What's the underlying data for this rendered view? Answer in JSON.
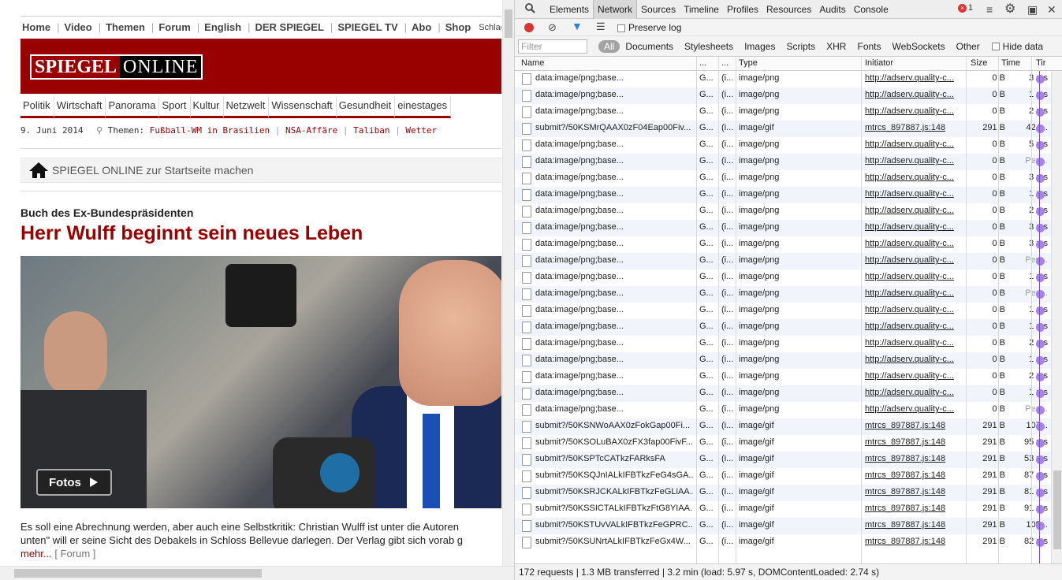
{
  "page": {
    "topnav": [
      "Home",
      "Video",
      "Themen",
      "Forum",
      "English",
      "DER SPIEGEL",
      "SPIEGEL TV",
      "Abo",
      "Shop"
    ],
    "search_label": "Schlag:",
    "logo_left": "SPIEGEL",
    "logo_right": "ONLINE",
    "categories": [
      "Politik",
      "Wirtschaft",
      "Panorama",
      "Sport",
      "Kultur",
      "Netzwelt",
      "Wissenschaft",
      "Gesundheit",
      "einestages"
    ],
    "category_colors": [
      "#990000",
      "#990000",
      "#990000",
      "#990000",
      "#990000",
      "#990000",
      "#990000",
      "#990000",
      "#990000"
    ],
    "date": "9. Juni 2014",
    "themen_label": "Themen:",
    "topics": [
      "Fußball-WM in Brasilien",
      "NSA-Affäre",
      "Taliban",
      "Wetter"
    ],
    "home_bar": "SPIEGEL ONLINE zur Startseite machen",
    "kicker": "Buch des Ex-Bundespräsidenten",
    "headline": "Herr Wulff beginnt sein neues Leben",
    "fotos_label": "Fotos",
    "teaser_line1": "Es soll eine Abrechnung werden, aber auch eine Selbstkritik: Christian Wulff ist unter die Autoren",
    "teaser_line2": "unten\" will er seine Sicht des Debakels in Schloss Bellevue darlegen. Der Verlag gibt sich vorab g",
    "more_label": "mehr...",
    "forum_label": "[ Forum ]"
  },
  "devtools": {
    "tabs": [
      "Elements",
      "Network",
      "Sources",
      "Timeline",
      "Profiles",
      "Resources",
      "Audits",
      "Console"
    ],
    "active_tab": "Network",
    "error_count": "1",
    "preserve_log": "Preserve log",
    "filter_placeholder": "Filter",
    "filter_types": [
      "All",
      "Documents",
      "Stylesheets",
      "Images",
      "Scripts",
      "XHR",
      "Fonts",
      "WebSockets",
      "Other"
    ],
    "hide_data": "Hide data",
    "columns": [
      "Name",
      "...",
      "...",
      "Type",
      "Initiator",
      "Size",
      "Time",
      "Tir"
    ],
    "rows": [
      {
        "name": "data:image/png;base...",
        "m1": "G...",
        "m2": "(i...",
        "type": "image/png",
        "init": "http://adserv.quality-c...",
        "size": "0 B",
        "time": "3 ms"
      },
      {
        "name": "data:image/png;base...",
        "m1": "G...",
        "m2": "(i...",
        "type": "image/png",
        "init": "http://adserv.quality-c...",
        "size": "0 B",
        "time": "1 ms"
      },
      {
        "name": "data:image/png;base...",
        "m1": "G...",
        "m2": "(i...",
        "type": "image/png",
        "init": "http://adserv.quality-c...",
        "size": "0 B",
        "time": "2 ms"
      },
      {
        "name": "submit?/50KSMrQAAX0zF04Eap00Fiv...",
        "m1": "G...",
        "m2": "(i...",
        "type": "image/gif",
        "init": "mtrcs_897887.js:148",
        "size": "291 B",
        "time": "424..."
      },
      {
        "name": "data:image/png;base...",
        "m1": "G...",
        "m2": "(i...",
        "type": "image/png",
        "init": "http://adserv.quality-c...",
        "size": "0 B",
        "time": "5 ms"
      },
      {
        "name": "data:image/png;base...",
        "m1": "G...",
        "m2": "(i...",
        "type": "image/png",
        "init": "http://adserv.quality-c...",
        "size": "0 B",
        "time": "Pen..."
      },
      {
        "name": "data:image/png;base...",
        "m1": "G...",
        "m2": "(i...",
        "type": "image/png",
        "init": "http://adserv.quality-c...",
        "size": "0 B",
        "time": "3 ms"
      },
      {
        "name": "data:image/png;base...",
        "m1": "G...",
        "m2": "(i...",
        "type": "image/png",
        "init": "http://adserv.quality-c...",
        "size": "0 B",
        "time": "1 ms"
      },
      {
        "name": "data:image/png;base...",
        "m1": "G...",
        "m2": "(i...",
        "type": "image/png",
        "init": "http://adserv.quality-c...",
        "size": "0 B",
        "time": "2 ms"
      },
      {
        "name": "data:image/png;base...",
        "m1": "G...",
        "m2": "(i...",
        "type": "image/png",
        "init": "http://adserv.quality-c...",
        "size": "0 B",
        "time": "3 ms"
      },
      {
        "name": "data:image/png;base...",
        "m1": "G...",
        "m2": "(i...",
        "type": "image/png",
        "init": "http://adserv.quality-c...",
        "size": "0 B",
        "time": "3 ms"
      },
      {
        "name": "data:image/png;base...",
        "m1": "G...",
        "m2": "(i...",
        "type": "image/png",
        "init": "http://adserv.quality-c...",
        "size": "0 B",
        "time": "Pen..."
      },
      {
        "name": "data:image/png;base...",
        "m1": "G...",
        "m2": "(i...",
        "type": "image/png",
        "init": "http://adserv.quality-c...",
        "size": "0 B",
        "time": "1 ms"
      },
      {
        "name": "data:image/png;base...",
        "m1": "G...",
        "m2": "(i...",
        "type": "image/png",
        "init": "http://adserv.quality-c...",
        "size": "0 B",
        "time": "Pen..."
      },
      {
        "name": "data:image/png;base...",
        "m1": "G...",
        "m2": "(i...",
        "type": "image/png",
        "init": "http://adserv.quality-c...",
        "size": "0 B",
        "time": "1 ms"
      },
      {
        "name": "data:image/png;base...",
        "m1": "G...",
        "m2": "(i...",
        "type": "image/png",
        "init": "http://adserv.quality-c...",
        "size": "0 B",
        "time": "1 ms"
      },
      {
        "name": "data:image/png;base...",
        "m1": "G...",
        "m2": "(i...",
        "type": "image/png",
        "init": "http://adserv.quality-c...",
        "size": "0 B",
        "time": "2 ms"
      },
      {
        "name": "data:image/png;base...",
        "m1": "G...",
        "m2": "(i...",
        "type": "image/png",
        "init": "http://adserv.quality-c...",
        "size": "0 B",
        "time": "1 ms"
      },
      {
        "name": "data:image/png;base...",
        "m1": "G...",
        "m2": "(i...",
        "type": "image/png",
        "init": "http://adserv.quality-c...",
        "size": "0 B",
        "time": "2 ms"
      },
      {
        "name": "data:image/png;base...",
        "m1": "G...",
        "m2": "(i...",
        "type": "image/png",
        "init": "http://adserv.quality-c...",
        "size": "0 B",
        "time": "1 ms"
      },
      {
        "name": "data:image/png;base...",
        "m1": "G...",
        "m2": "(i...",
        "type": "image/png",
        "init": "http://adserv.quality-c...",
        "size": "0 B",
        "time": "Pen..."
      },
      {
        "name": "submit?/50KSNWoAAX0zFokGap00Fi...",
        "m1": "G...",
        "m2": "(i...",
        "type": "image/gif",
        "init": "mtrcs_897887.js:148",
        "size": "291 B",
        "time": "107..."
      },
      {
        "name": "submit?/50KSOLuBAX0zFX3fap00FivF...",
        "m1": "G...",
        "m2": "(i...",
        "type": "image/gif",
        "init": "mtrcs_897887.js:148",
        "size": "291 B",
        "time": "95 ms"
      },
      {
        "name": "submit?/50KSPTcCATkzFARksFA",
        "m1": "G...",
        "m2": "(i...",
        "type": "image/gif",
        "init": "mtrcs_897887.js:148",
        "size": "291 B",
        "time": "53 ms"
      },
      {
        "name": "submit?/50KSQJnIALkIFBTkzFeG4sGA...",
        "m1": "G...",
        "m2": "(i...",
        "type": "image/gif",
        "init": "mtrcs_897887.js:148",
        "size": "291 B",
        "time": "87 ms"
      },
      {
        "name": "submit?/50KSRJCKALkIFBTkzFeGLiAA...",
        "m1": "G...",
        "m2": "(i...",
        "type": "image/gif",
        "init": "mtrcs_897887.js:148",
        "size": "291 B",
        "time": "81 ms"
      },
      {
        "name": "submit?/50KSSICTALkIFBTkzFtG8YIAA...",
        "m1": "G...",
        "m2": "(i...",
        "type": "image/gif",
        "init": "mtrcs_897887.js:148",
        "size": "291 B",
        "time": "91 ms"
      },
      {
        "name": "submit?/50KSTUvVALkIFBTkzFeGPRC...",
        "m1": "G...",
        "m2": "(i...",
        "type": "image/gif",
        "init": "mtrcs_897887.js:148",
        "size": "291 B",
        "time": "105..."
      },
      {
        "name": "submit?/50KSUNrtALkIFBTkzFeGx4W...",
        "m1": "G...",
        "m2": "(i...",
        "type": "image/gif",
        "init": "mtrcs_897887.js:148",
        "size": "291 B",
        "time": "82 ms"
      }
    ],
    "status": "172 requests | 1.3 MB transferred | 3.2 min (load: 5.97 s, DOMContentLoaded: 2.74 s)"
  }
}
